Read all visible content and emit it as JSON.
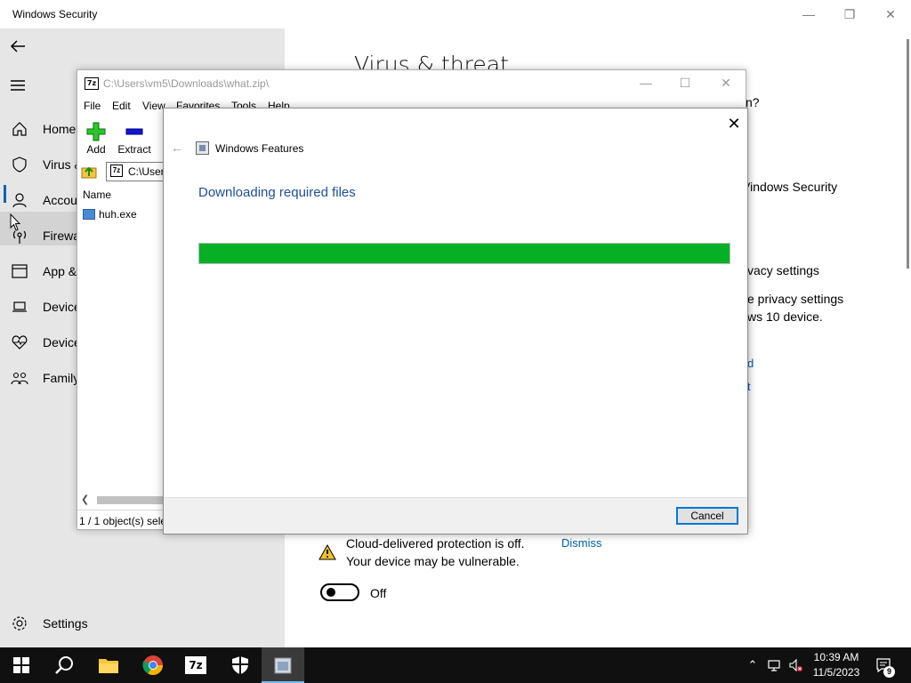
{
  "windows_security": {
    "title": "Windows Security",
    "content_title": "Virus & threat",
    "nav": [
      {
        "label": "Home",
        "icon": "home-icon"
      },
      {
        "label": "Virus &",
        "icon": "shield-icon"
      },
      {
        "label": "Accou",
        "icon": "person-icon"
      },
      {
        "label": "Firewa",
        "icon": "wifi-antenna-icon"
      },
      {
        "label": "App &",
        "icon": "app-browser-icon"
      },
      {
        "label": "Device",
        "icon": "laptop-icon"
      },
      {
        "label": "Device",
        "icon": "heart-pulse-icon"
      },
      {
        "label": "Family",
        "icon": "family-icon"
      }
    ],
    "settings_label": "Settings",
    "right_partial_texts": {
      "question": "n?",
      "windows_security": "Vindows Security",
      "privacy_heading": "vacy settings",
      "privacy_line1": "e privacy settings",
      "privacy_line2": "ws 10 device.",
      "link1": "d",
      "link2": "t"
    },
    "warning_line1": "Cloud-delivered protection is off.",
    "warning_line2": "Your device may be vulnerable.",
    "dismiss_label": "Dismiss",
    "toggle_label": "Off"
  },
  "sevenzip": {
    "title": "C:\\Users\\vm5\\Downloads\\what.zip\\",
    "menu": [
      "File",
      "Edit",
      "View",
      "Favorites",
      "Tools",
      "Help"
    ],
    "toolbar": {
      "add_label": "Add",
      "extract_label": "Extract"
    },
    "address": "C:\\Users",
    "list_header": "Name",
    "files": [
      {
        "name": "huh.exe"
      }
    ],
    "status": "1 / 1 object(s) sele",
    "app_icon_text": "7z"
  },
  "windows_features": {
    "app_name": "Windows Features",
    "heading": "Downloading required files",
    "progress": 1.0,
    "cancel_label": "Cancel"
  },
  "taskbar": {
    "time": "10:39 AM",
    "date": "11/5/2023",
    "notification_count": "9",
    "sevenzip_icon_text": "7z"
  },
  "colors": {
    "progress_green": "#06b025",
    "heading_blue": "#1e4f9a",
    "link_blue": "#0063b1",
    "taskbar": "#101010"
  }
}
